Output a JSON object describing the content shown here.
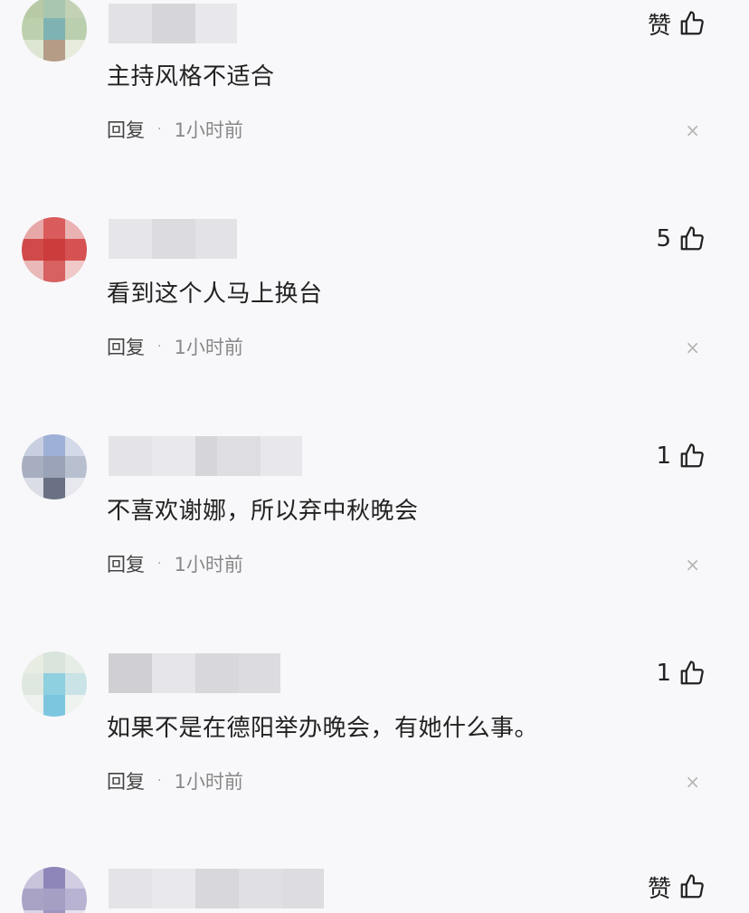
{
  "comments": [
    {
      "likes": "赞",
      "text": "主持风格不适合",
      "reply_label": "回复",
      "separator": "·",
      "time": "1小时前",
      "close_glyph": "×"
    },
    {
      "likes": "5",
      "text": "看到这个人马上换台",
      "reply_label": "回复",
      "separator": "·",
      "time": "1小时前",
      "close_glyph": "×"
    },
    {
      "likes": "1",
      "text": "不喜欢谢娜，所以弃中秋晚会",
      "reply_label": "回复",
      "separator": "·",
      "time": "1小时前",
      "close_glyph": "×"
    },
    {
      "likes": "1",
      "text": "如果不是在德阳举办晚会，有她什么事。",
      "reply_label": "回复",
      "separator": "·",
      "time": "1小时前",
      "close_glyph": "×"
    },
    {
      "likes": "赞"
    }
  ],
  "icons": {
    "like": "thumbs-up-icon",
    "close": "close-icon"
  },
  "colors": {
    "background": "#f8f8fa",
    "text": "#222222",
    "meta": "#888888",
    "close": "#b5b5b5"
  }
}
